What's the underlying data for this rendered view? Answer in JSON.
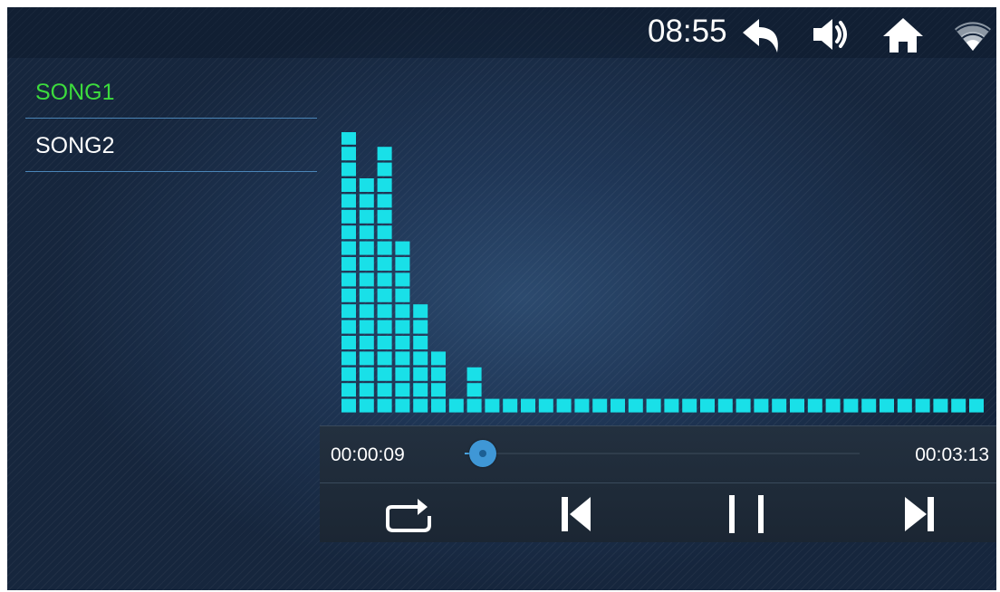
{
  "status_bar": {
    "time": "08:55",
    "icons": [
      "back-icon",
      "volume-icon",
      "home-icon",
      "wifi-icon"
    ]
  },
  "playlist": {
    "songs": [
      {
        "title": "SONG1",
        "active": true
      },
      {
        "title": "SONG2",
        "active": false
      }
    ]
  },
  "visualizer": {
    "bar_levels": [
      18,
      15,
      17,
      11,
      7,
      4,
      1,
      3,
      1,
      1,
      1,
      1,
      1,
      1,
      1,
      1,
      1,
      1,
      1,
      1,
      1,
      1,
      1,
      1,
      1,
      1,
      1,
      1,
      1,
      1,
      1,
      1,
      1,
      1,
      1,
      1
    ],
    "color": "#19e0e8"
  },
  "player": {
    "elapsed": "00:00:09",
    "total": "00:03:13",
    "progress_fraction": 0.047,
    "buttons": [
      "repeat-icon",
      "previous-icon",
      "pause-icon",
      "next-icon"
    ]
  },
  "colors": {
    "active_song": "#3ddc3d",
    "accent": "#3f97d6"
  }
}
